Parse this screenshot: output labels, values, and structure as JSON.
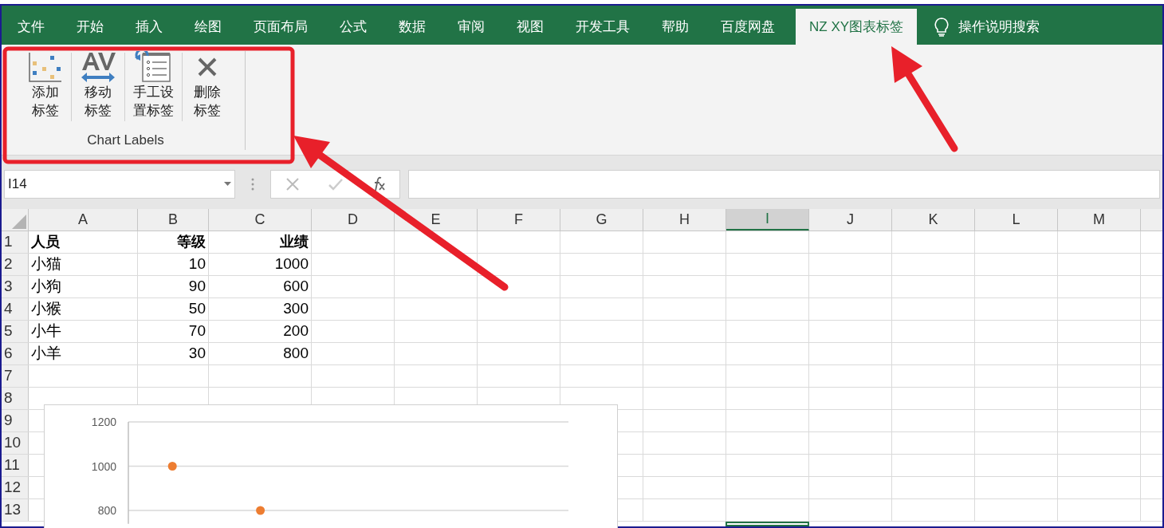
{
  "menu_tabs": [
    {
      "label": "文件",
      "selected": false
    },
    {
      "label": "开始",
      "selected": false
    },
    {
      "label": "插入",
      "selected": false
    },
    {
      "label": "绘图",
      "selected": false
    },
    {
      "label": "页面布局",
      "selected": false
    },
    {
      "label": "公式",
      "selected": false
    },
    {
      "label": "数据",
      "selected": false
    },
    {
      "label": "审阅",
      "selected": false
    },
    {
      "label": "视图",
      "selected": false
    },
    {
      "label": "开发工具",
      "selected": false
    },
    {
      "label": "帮助",
      "selected": false
    },
    {
      "label": "百度网盘",
      "selected": false
    },
    {
      "label": "NZ XY图表标签",
      "selected": true
    }
  ],
  "tell_me": {
    "label": "操作说明搜索"
  },
  "ribbon": {
    "group_label": "Chart Labels",
    "buttons": [
      {
        "kind": "add",
        "lines": [
          "添加",
          "标签"
        ]
      },
      {
        "kind": "move",
        "lines": [
          "移动",
          "标签"
        ]
      },
      {
        "kind": "manual",
        "lines": [
          "手工设",
          "置标签"
        ]
      },
      {
        "kind": "delete",
        "lines": [
          "删除",
          "标签"
        ]
      }
    ]
  },
  "formula_bar": {
    "name_box": "I14"
  },
  "columns": [
    {
      "label": "A",
      "selected": false
    },
    {
      "label": "B",
      "selected": false
    },
    {
      "label": "C",
      "selected": false
    },
    {
      "label": "D",
      "selected": false
    },
    {
      "label": "E",
      "selected": false
    },
    {
      "label": "F",
      "selected": false
    },
    {
      "label": "G",
      "selected": false
    },
    {
      "label": "H",
      "selected": false
    },
    {
      "label": "I",
      "selected": true
    },
    {
      "label": "J",
      "selected": false
    },
    {
      "label": "K",
      "selected": false
    },
    {
      "label": "L",
      "selected": false
    },
    {
      "label": "M",
      "selected": false
    }
  ],
  "rows": [
    {
      "number": "1",
      "bold": true,
      "cells": [
        "人员",
        "等级",
        "业绩"
      ]
    },
    {
      "number": "2",
      "bold": false,
      "cells": [
        "小猫",
        "10",
        "1000"
      ]
    },
    {
      "number": "3",
      "bold": false,
      "cells": [
        "小狗",
        "90",
        "600"
      ]
    },
    {
      "number": "4",
      "bold": false,
      "cells": [
        "小猴",
        "50",
        "300"
      ]
    },
    {
      "number": "5",
      "bold": false,
      "cells": [
        "小牛",
        "70",
        "200"
      ]
    },
    {
      "number": "6",
      "bold": false,
      "cells": [
        "小羊",
        "30",
        "800"
      ]
    },
    {
      "number": "7",
      "cells": []
    },
    {
      "number": "8",
      "cells": []
    },
    {
      "number": "9",
      "cells": []
    },
    {
      "number": "10",
      "cells": []
    },
    {
      "number": "11",
      "cells": []
    },
    {
      "number": "12",
      "cells": []
    },
    {
      "number": "13",
      "cells": []
    }
  ],
  "chart": {
    "chart_data": {
      "type": "scatter",
      "categories": [
        null,
        null,
        null,
        null,
        null
      ],
      "ylim": [
        740,
        1200
      ],
      "yticks": [
        800,
        1000,
        1200
      ],
      "series": [
        {
          "color": "#ed7d31",
          "values": [
            1000,
            800,
            null,
            null,
            null
          ]
        }
      ]
    }
  }
}
